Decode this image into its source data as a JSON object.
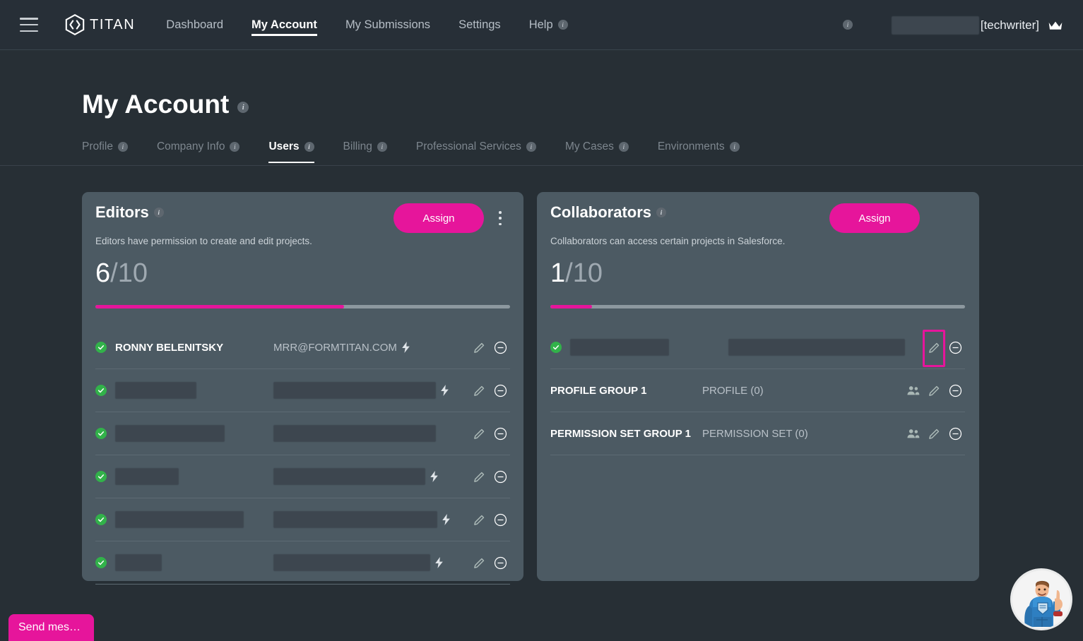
{
  "topbar": {
    "menu_icon": "hamburger-icon",
    "brand": "TITAN",
    "nav": [
      {
        "label": "Dashboard",
        "active": false,
        "info": false
      },
      {
        "label": "My Account",
        "active": true,
        "info": false
      },
      {
        "label": "My Submissions",
        "active": false,
        "info": false
      },
      {
        "label": "Settings",
        "active": false,
        "info": false
      },
      {
        "label": "Help",
        "active": false,
        "info": true
      }
    ],
    "user_name": "[techwriter]",
    "user_name_redacted": true,
    "crown_icon": "crown-icon"
  },
  "page": {
    "title": "My Account",
    "tabs": [
      {
        "label": "Profile",
        "active": false
      },
      {
        "label": "Company Info",
        "active": false
      },
      {
        "label": "Users",
        "active": true
      },
      {
        "label": "Billing",
        "active": false
      },
      {
        "label": "Professional Services",
        "active": false
      },
      {
        "label": "My Cases",
        "active": false
      },
      {
        "label": "Environments",
        "active": false
      }
    ]
  },
  "editors": {
    "title": "Editors",
    "description": "Editors have permission to create and edit projects.",
    "assign_label": "Assign",
    "used": "6",
    "separator": "/",
    "limit": "10",
    "progress_percent": 60,
    "rows": [
      {
        "name": "RONNY BELENITSKY",
        "sub": "MRR@FORMTITAN.COM",
        "redacted": false,
        "bolt": true,
        "check": true,
        "name_w": 224,
        "sub_w": 230
      },
      {
        "name": "",
        "sub": "",
        "redacted": true,
        "bolt": true,
        "check": true,
        "name_w": 115,
        "sub_w": 230
      },
      {
        "name": "",
        "sub": "",
        "redacted": true,
        "bolt": false,
        "check": true,
        "name_w": 155,
        "sub_w": 230
      },
      {
        "name": "",
        "sub": "",
        "redacted": true,
        "bolt": true,
        "check": true,
        "name_w": 90,
        "sub_w": 215
      },
      {
        "name": "",
        "sub": "",
        "redacted": true,
        "bolt": true,
        "check": true,
        "name_w": 182,
        "sub_w": 232
      },
      {
        "name": "",
        "sub": "",
        "redacted": true,
        "bolt": true,
        "check": true,
        "name_w": 66,
        "sub_w": 222
      }
    ]
  },
  "collaborators": {
    "title": "Collaborators",
    "description": "Collaborators can access certain projects in Salesforce.",
    "assign_label": "Assign",
    "used": "1",
    "separator": "/",
    "limit": "10",
    "progress_percent": 10,
    "rows": [
      {
        "name": "",
        "sub": "",
        "redacted": true,
        "check": true,
        "people": false,
        "highlighted": true,
        "name_w": 140,
        "sub_w": 250
      },
      {
        "name": "PROFILE GROUP 1",
        "sub": "PROFILE (0)",
        "redacted": false,
        "check": false,
        "people": true,
        "highlighted": false,
        "name_w": 215,
        "sub_w": 250
      },
      {
        "name": "PERMISSION SET GROUP 1",
        "sub": "PERMISSION SET (0)",
        "redacted": false,
        "check": false,
        "people": true,
        "highlighted": false,
        "name_w": 215,
        "sub_w": 250
      }
    ]
  },
  "chat": {
    "send_label": "Send mes…",
    "avatar_icon": "support-hero-avatar"
  },
  "colors": {
    "page_bg": "#272f35",
    "topbar_bg": "#272f37",
    "card_bg": "#4c5a63",
    "accent": "#e6159b",
    "progress_track": "#8d989f",
    "check_green": "#32b24a",
    "muted_text": "#b9c1c8"
  }
}
